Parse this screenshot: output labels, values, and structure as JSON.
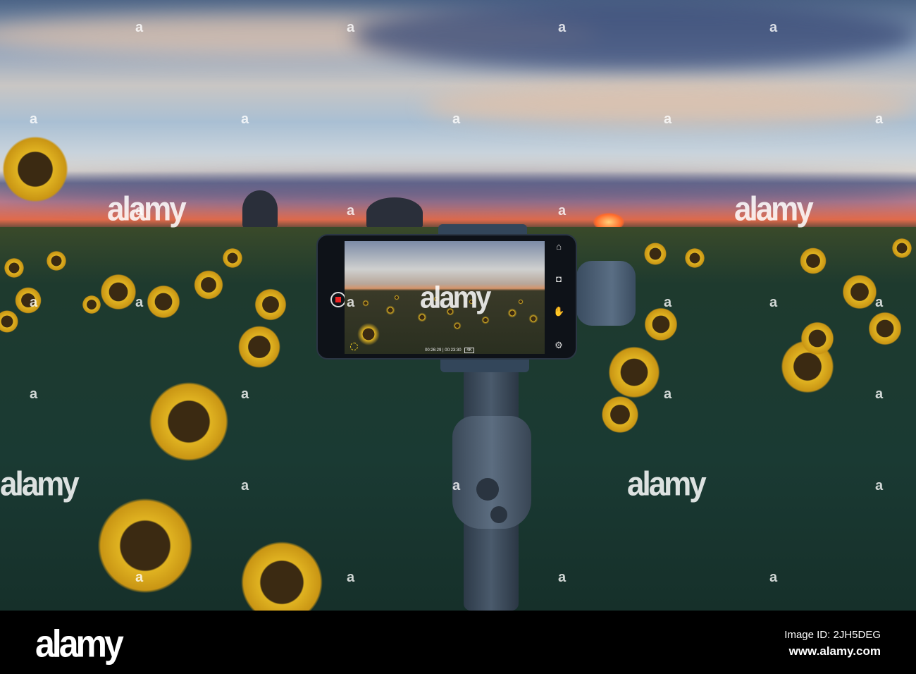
{
  "watermark": "alamy",
  "watermark_small": "a",
  "phone_app": {
    "timecode": "00:26:29 | 00:23:30",
    "resolution_badge": "4K"
  },
  "footer": {
    "logo": "alamy",
    "image_id": "Image ID: 2JH5DEG",
    "site": "www.alamy.com"
  }
}
